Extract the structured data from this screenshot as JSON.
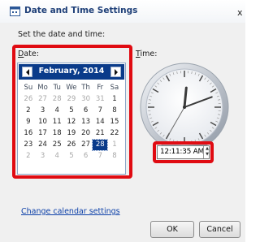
{
  "window": {
    "title": "Date and Time Settings",
    "close_glyph": "x"
  },
  "prompt": "Set the date and time:",
  "date": {
    "label_key": "D",
    "label_rest": "ate:",
    "calendar": {
      "month_label": "February, 2014",
      "prev_icon": "chevron-left-icon",
      "next_icon": "chevron-right-icon",
      "weekdays": [
        "Su",
        "Mo",
        "Tu",
        "We",
        "Th",
        "Fr",
        "Sa"
      ],
      "weeks": [
        [
          "26",
          "27",
          "28",
          "29",
          "30",
          "31",
          "1"
        ],
        [
          "2",
          "3",
          "4",
          "5",
          "6",
          "7",
          "8"
        ],
        [
          "9",
          "10",
          "11",
          "12",
          "13",
          "14",
          "15"
        ],
        [
          "16",
          "17",
          "18",
          "19",
          "20",
          "21",
          "22"
        ],
        [
          "23",
          "24",
          "25",
          "26",
          "27",
          "28",
          "1"
        ],
        [
          "2",
          "3",
          "4",
          "5",
          "6",
          "7",
          "8"
        ]
      ],
      "selected_day": "28"
    }
  },
  "time": {
    "label_key": "T",
    "label_rest": "ime:",
    "value": "12:11:35 AM",
    "clock": {
      "hour": 12,
      "minute": 11,
      "second": 35
    }
  },
  "link": "Change calendar settings",
  "buttons": {
    "ok": "OK",
    "cancel": "Cancel"
  },
  "colors": {
    "highlight": "#e00b12",
    "calendar_header": "#0a3b8a",
    "link": "#0b3fa8"
  }
}
